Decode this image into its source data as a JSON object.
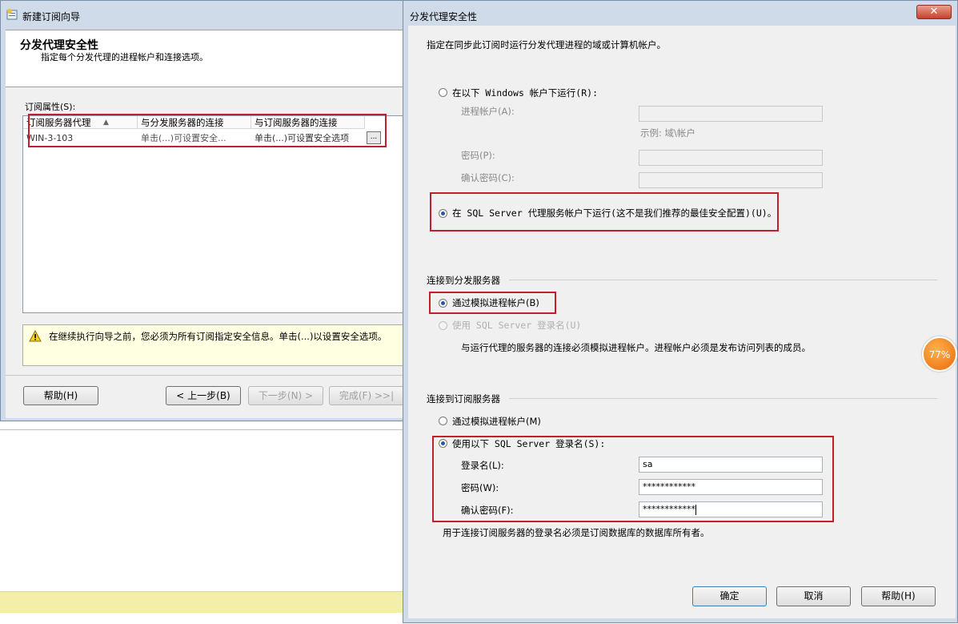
{
  "wizard": {
    "title": "新建订阅向导",
    "header_title": "分发代理安全性",
    "header_subtitle": "指定每个分发代理的进程帐户和连接选项。",
    "props_label": "订阅属性(S):",
    "columns": [
      "订阅服务器代理",
      "与分发服务器的连接",
      "与订阅服务器的连接"
    ],
    "rows": [
      {
        "agent": "WIN-3-103",
        "dist_conn": "单击(...)可设置安全...",
        "sub_conn": "单击(...)可设置安全选项",
        "button": "..."
      }
    ],
    "warning": "在继续执行向导之前，您必须为所有订阅指定安全信息。单击(...)以设置安全选项。",
    "buttons": {
      "help": "帮助(H)",
      "back": "< 上一步(B)",
      "next": "下一步(N) >",
      "finish": "完成(F) >>|"
    }
  },
  "dialog": {
    "title": "分发代理安全性",
    "close_glyph": "✕",
    "intro": "指定在同步此订阅时运行分发代理进程的域或计算机帐户。",
    "process": {
      "opt_windows": "在以下 Windows 帐户下运行(R):",
      "account_label": "进程帐户(A):",
      "example": "示例: 域\\帐户",
      "password_label": "密码(P):",
      "confirm_label": "确认密码(C):",
      "opt_sqlagent": "在 SQL Server 代理服务帐户下运行(这不是我们推荐的最佳安全配置)(U)。"
    },
    "distributor": {
      "section": "连接到分发服务器",
      "opt_impersonate": "通过模拟进程帐户(B)",
      "opt_sql": "使用 SQL Server 登录名(U)",
      "note": "与运行代理的服务器的连接必须模拟进程帐户。进程帐户必须是发布访问列表的成员。"
    },
    "subscriber": {
      "section": "连接到订阅服务器",
      "opt_impersonate": "通过模拟进程帐户(M)",
      "opt_sql": "使用以下 SQL Server 登录名(S):",
      "login_label": "登录名(L):",
      "login_value": "sa",
      "password_label": "密码(W):",
      "password_value": "************",
      "confirm_label": "确认密码(F):",
      "confirm_value": "************",
      "note": "用于连接订阅服务器的登录名必须是订阅数据库的数据库所有者。"
    },
    "buttons": {
      "ok": "确定",
      "cancel": "取消",
      "help": "帮助(H)"
    }
  },
  "badge": {
    "text": "77%"
  },
  "colors": {
    "highlight_border": "#c0202a",
    "badge": "#e86a10",
    "warning_bg": "#ffffe1"
  }
}
